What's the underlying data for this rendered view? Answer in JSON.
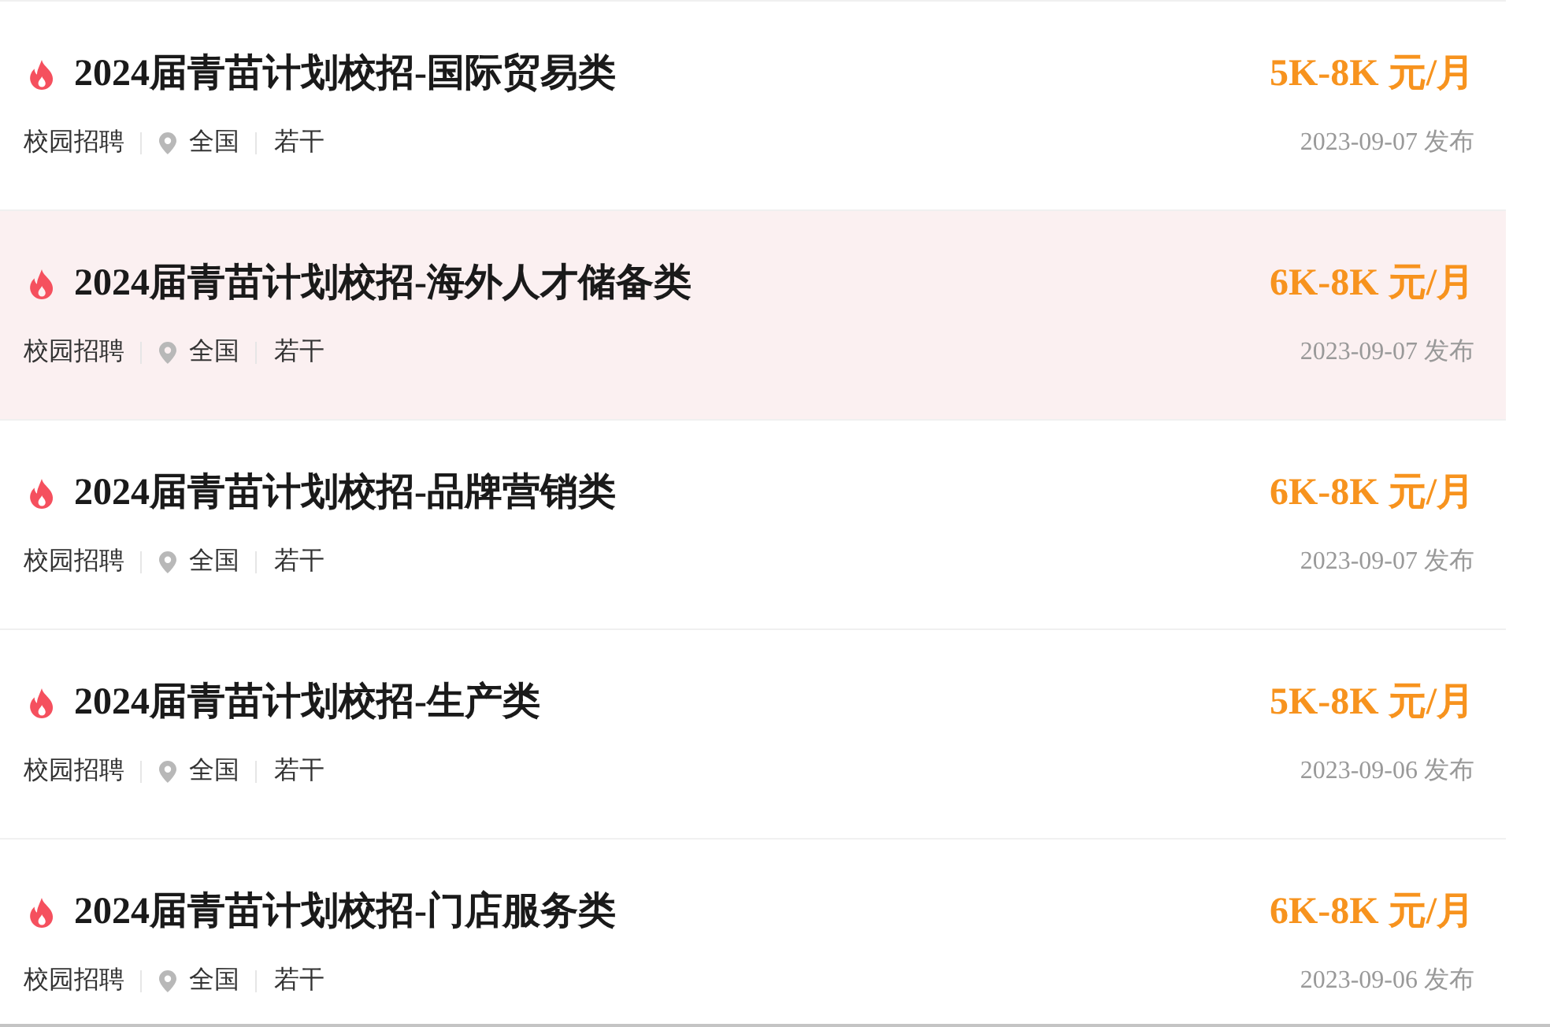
{
  "jobs": [
    {
      "title": "2024届青苗计划校招-国际贸易类",
      "salary": "5K-8K 元/月",
      "type": "校园招聘",
      "location": "全国",
      "headcount": "若干",
      "date": "2023-09-07 发布",
      "highlighted": false
    },
    {
      "title": "2024届青苗计划校招-海外人才储备类",
      "salary": "6K-8K 元/月",
      "type": "校园招聘",
      "location": "全国",
      "headcount": "若干",
      "date": "2023-09-07 发布",
      "highlighted": true
    },
    {
      "title": "2024届青苗计划校招-品牌营销类",
      "salary": "6K-8K 元/月",
      "type": "校园招聘",
      "location": "全国",
      "headcount": "若干",
      "date": "2023-09-07 发布",
      "highlighted": false
    },
    {
      "title": "2024届青苗计划校招-生产类",
      "salary": "5K-8K 元/月",
      "type": "校园招聘",
      "location": "全国",
      "headcount": "若干",
      "date": "2023-09-06 发布",
      "highlighted": false
    },
    {
      "title": "2024届青苗计划校招-门店服务类",
      "salary": "6K-8K 元/月",
      "type": "校园招聘",
      "location": "全国",
      "headcount": "若干",
      "date": "2023-09-06 发布",
      "highlighted": false
    }
  ]
}
